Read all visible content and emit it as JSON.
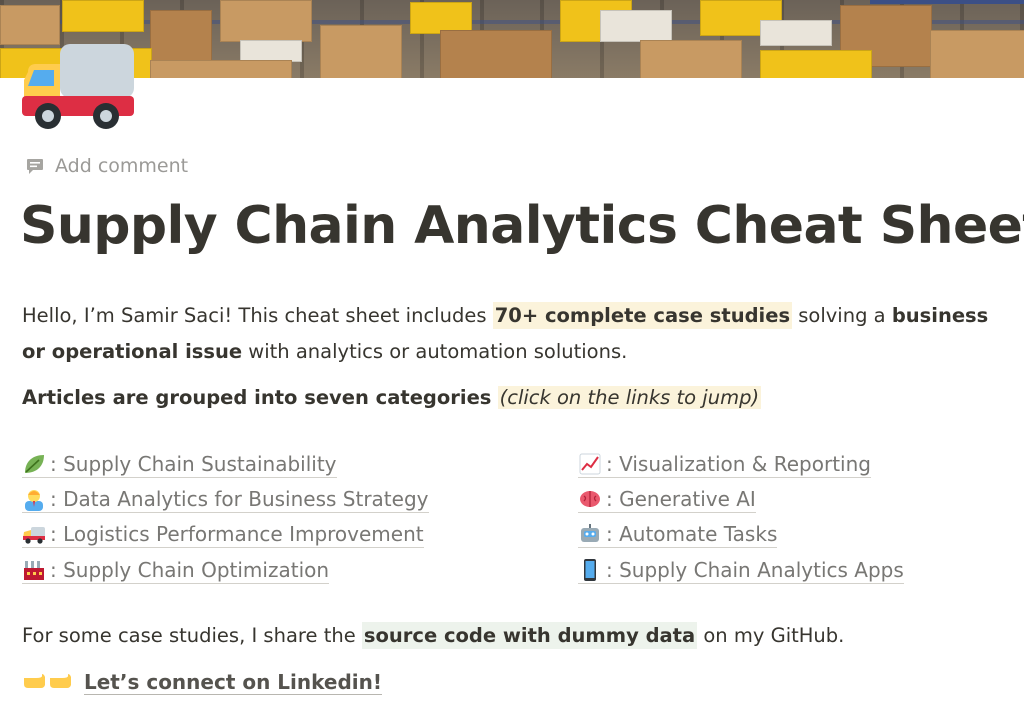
{
  "add_comment": {
    "label": "Add comment"
  },
  "title": "Supply Chain Analytics Cheat Sheet",
  "intro": {
    "part1": "Hello, I’m Samir Saci! This cheat sheet includes ",
    "highlight": "70+ complete case studies",
    "part2": " solving a ",
    "bold": "business or operational issue",
    "part3": " with analytics or automation solutions."
  },
  "grouping": {
    "bold": "Articles are grouped into seven categories",
    "italic": "(click on the links to jump)"
  },
  "categories_left": [
    {
      "icon": "leaf-icon",
      "label": ": Supply Chain Sustainability"
    },
    {
      "icon": "business-person-icon",
      "label": ": Data Analytics for Business Strategy"
    },
    {
      "icon": "delivery-truck-icon",
      "label": ": Logistics Performance Improvement"
    },
    {
      "icon": "factory-icon",
      "label": ": Supply Chain Optimization"
    }
  ],
  "categories_right": [
    {
      "icon": "chart-increasing-icon",
      "label": ": Visualization & Reporting"
    },
    {
      "icon": "brain-icon",
      "label": ": Generative AI"
    },
    {
      "icon": "robot-icon",
      "label": ": Automate Tasks"
    },
    {
      "icon": "mobile-phone-icon",
      "label": ": Supply Chain Analytics Apps"
    }
  ],
  "source": {
    "part1": "For some case studies, I share the ",
    "highlight": "source code with dummy data",
    "part2": " on my GitHub."
  },
  "connect": {
    "label": "Let’s connect on Linkedin!"
  },
  "colors": {
    "text": "#37352f",
    "muted": "#787774",
    "highlight_yellow": "#fbf3db",
    "highlight_green": "#edf3ec"
  }
}
